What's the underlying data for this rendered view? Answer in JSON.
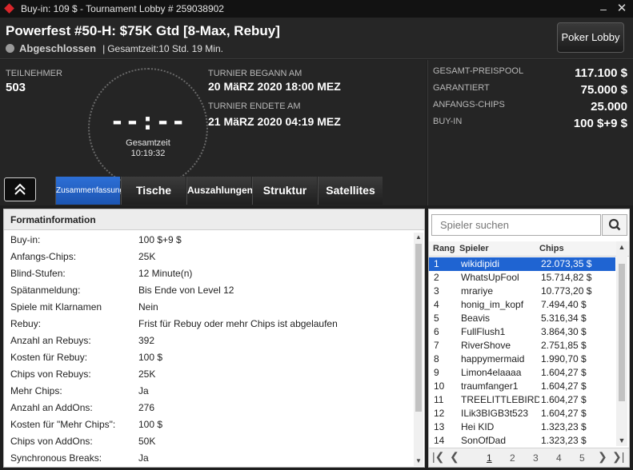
{
  "window": {
    "title": "Buy-in: 109 $ - Tournament Lobby # 259038902",
    "minimize": "–",
    "close": "✕"
  },
  "header": {
    "name": "Powerfest #50-H: $75K Gtd [8-Max, Rebuy]",
    "status": "Abgeschlossen",
    "separator": "|",
    "duration": "Gesamtzeit:10 Std.  19 Min.",
    "lobby_button": "Poker Lobby"
  },
  "info": {
    "participants_label": "TEILNEHMER",
    "participants": "503",
    "clock_digits": "--:--",
    "clock_label": "Gesamtzeit",
    "clock_time": "10:19:32",
    "start_label": "TURNIER BEGANN AM",
    "start_value": "20 MäRZ 2020  18:00 MEZ",
    "end_label": "TURNIER ENDETE AM",
    "end_value": "21 MäRZ 2020  04:19 MEZ"
  },
  "prize": {
    "rows": [
      {
        "label": "GESAMT-PREISPOOL",
        "value": "117.100 $"
      },
      {
        "label": "GARANTIERT",
        "value": "75.000 $"
      },
      {
        "label": "ANFANGS-CHIPS",
        "value": "25.000"
      },
      {
        "label": "BUY-IN",
        "value": "100 $+9 $"
      }
    ]
  },
  "tabs": [
    {
      "label": "Zusammenfassung",
      "active": true
    },
    {
      "label": "Tische"
    },
    {
      "label": "Auszahlungen"
    },
    {
      "label": "Struktur"
    },
    {
      "label": "Satellites"
    }
  ],
  "format": {
    "title": "Formatinformation",
    "rows": [
      {
        "k": "Buy-in:",
        "v": "100 $+9 $"
      },
      {
        "k": "Anfangs-Chips:",
        "v": "25K"
      },
      {
        "k": "Blind-Stufen:",
        "v": "12 Minute(n)"
      },
      {
        "k": "Spätanmeldung:",
        "v": "Bis Ende von Level 12"
      },
      {
        "k": "Spiele mit Klarnamen",
        "v": "Nein"
      },
      {
        "k": "Rebuy:",
        "v": "Frist für Rebuy oder mehr Chips ist abgelaufen"
      },
      {
        "k": "Anzahl an Rebuys:",
        "v": "392"
      },
      {
        "k": "Kosten für Rebuy:",
        "v": "100 $"
      },
      {
        "k": "Chips von Rebuys:",
        "v": "25K"
      },
      {
        "k": "Mehr Chips:",
        "v": "Ja"
      },
      {
        "k": "Anzahl an AddOns:",
        "v": "276"
      },
      {
        "k": "Kosten für \"Mehr Chips\":",
        "v": "100 $"
      },
      {
        "k": "Chips von AddOns:",
        "v": "50K"
      },
      {
        "k": "Synchronous Breaks:",
        "v": "Ja"
      }
    ]
  },
  "players": {
    "search_placeholder": "Spieler suchen",
    "headers": {
      "rank": "Rang",
      "player": "Spieler",
      "chips": "Chips"
    },
    "rows": [
      {
        "rank": "1",
        "name": "wikidipidi",
        "chips": "22.073,35 $",
        "selected": true
      },
      {
        "rank": "2",
        "name": "WhatsUpFool",
        "chips": "15.714,82 $"
      },
      {
        "rank": "3",
        "name": "mrariye",
        "chips": "10.773,20 $"
      },
      {
        "rank": "4",
        "name": "honig_im_kopf",
        "chips": "7.494,40 $"
      },
      {
        "rank": "5",
        "name": "Beavis",
        "chips": "5.316,34 $"
      },
      {
        "rank": "6",
        "name": "FullFlush1",
        "chips": "3.864,30 $"
      },
      {
        "rank": "7",
        "name": "RiverShove",
        "chips": "2.751,85 $"
      },
      {
        "rank": "8",
        "name": "happymermaid",
        "chips": "1.990,70 $"
      },
      {
        "rank": "9",
        "name": "Limon4elaaaa",
        "chips": "1.604,27 $"
      },
      {
        "rank": "10",
        "name": "traumfanger1",
        "chips": "1.604,27 $"
      },
      {
        "rank": "11",
        "name": "TREELITTLEBIRDS",
        "chips": "1.604,27 $"
      },
      {
        "rank": "12",
        "name": "ILik3BIGB3t523",
        "chips": "1.604,27 $"
      },
      {
        "rank": "13",
        "name": "Hei KID",
        "chips": "1.323,23 $"
      },
      {
        "rank": "14",
        "name": "SonOfDad",
        "chips": "1.323,23 $"
      }
    ],
    "pager": {
      "pages": [
        "1",
        "2",
        "3",
        "4",
        "5"
      ],
      "current": "1"
    }
  }
}
